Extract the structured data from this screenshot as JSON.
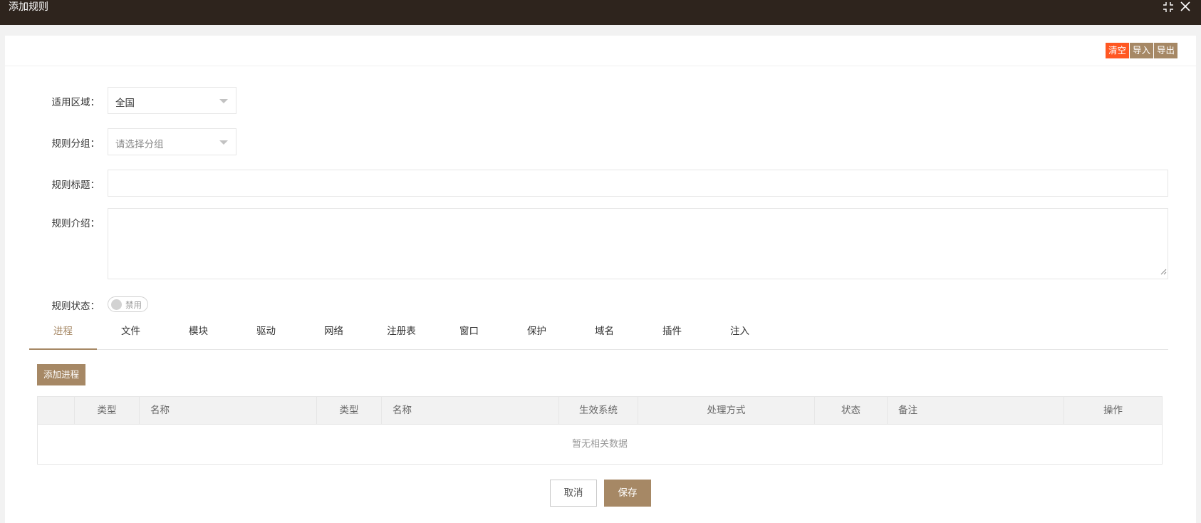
{
  "window": {
    "title": "添加规则",
    "restore_icon": "restore-icon",
    "close_icon": "close-icon"
  },
  "toolbar": {
    "clear_label": "清空",
    "import_label": "导入",
    "export_label": "导出"
  },
  "form": {
    "region": {
      "label": "适用区域：",
      "value": "全国"
    },
    "group": {
      "label": "规则分组：",
      "placeholder": "请选择分组"
    },
    "title": {
      "label": "规则标题：",
      "value": ""
    },
    "intro": {
      "label": "规则介绍：",
      "value": ""
    },
    "status": {
      "label": "规则状态：",
      "switch_text": "禁用",
      "enabled": false
    }
  },
  "tabs": [
    {
      "label": "进程",
      "active": true
    },
    {
      "label": "文件"
    },
    {
      "label": "模块"
    },
    {
      "label": "驱动"
    },
    {
      "label": "网络"
    },
    {
      "label": "注册表"
    },
    {
      "label": "窗口"
    },
    {
      "label": "保护"
    },
    {
      "label": "域名"
    },
    {
      "label": "插件"
    },
    {
      "label": "注入"
    }
  ],
  "add_button": "添加进程",
  "table": {
    "columns": [
      "",
      "类型",
      "名称",
      "类型",
      "名称",
      "生效系统",
      "处理方式",
      "状态",
      "备注",
      "操作"
    ],
    "empty_text": "暂无相关数据"
  },
  "footer": {
    "cancel_label": "取消",
    "save_label": "保存"
  },
  "colors": {
    "titlebar": "#2e241d",
    "accent": "#a68865",
    "danger": "#ff5722"
  }
}
